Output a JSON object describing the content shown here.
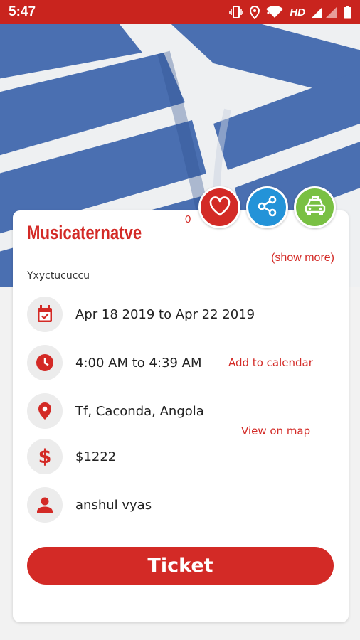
{
  "status_bar": {
    "time": "5:47",
    "network": "HD"
  },
  "event": {
    "likes": "0",
    "title": "Musicaternatve",
    "show_more": "(show more)",
    "description": "Yxyctucuccu",
    "date": "Apr 18 2019 to Apr 22 2019",
    "time": "4:00 AM to 4:39 AM",
    "add_to_calendar": "Add to calendar",
    "location": "Tf, Caconda, Angola",
    "view_on_map": "View on map",
    "price": "$1222",
    "organizer": "anshul vyas"
  },
  "ticket_label": "Ticket",
  "colors": {
    "primary": "#d32a26",
    "status_bar": "#c9241e",
    "share": "#2393d8",
    "taxi": "#79c043",
    "icon_bg": "#ececec"
  },
  "icons": [
    "vibrate-icon",
    "location-icon",
    "wifi-icon",
    "signal-icon",
    "battery-icon",
    "heart-icon",
    "share-icon",
    "taxi-icon",
    "calendar-icon",
    "clock-icon",
    "map-pin-icon",
    "dollar-icon",
    "person-icon"
  ]
}
